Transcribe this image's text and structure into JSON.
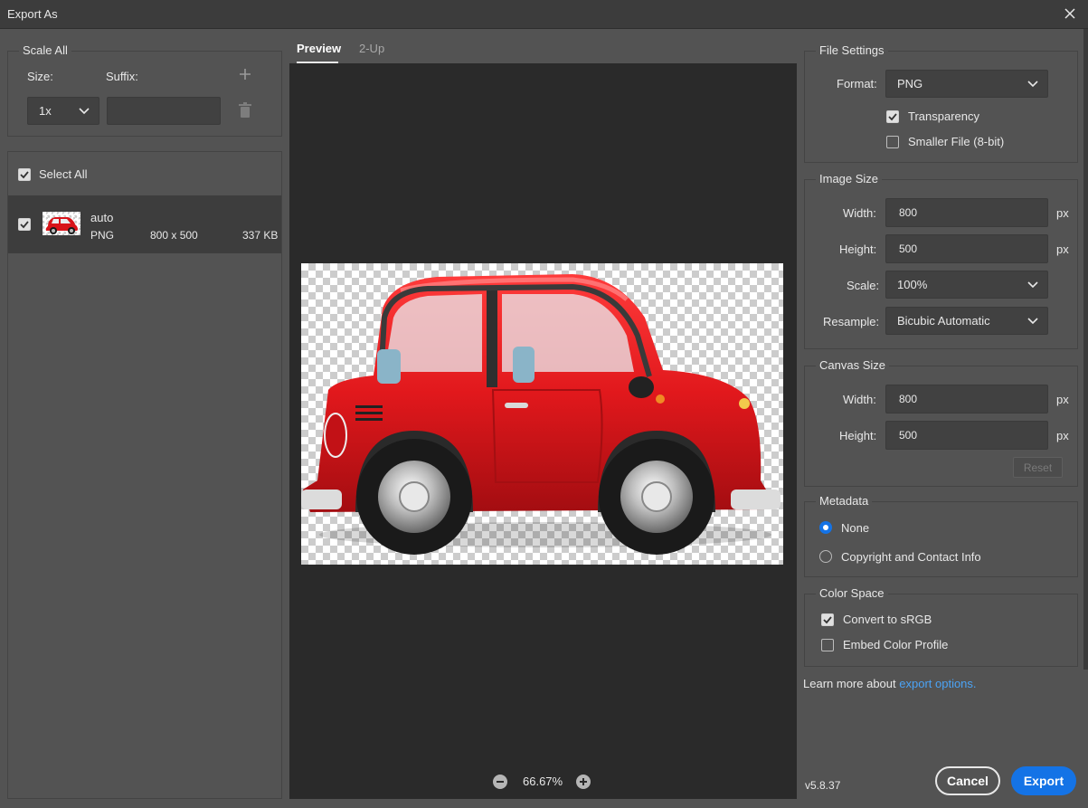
{
  "window": {
    "title": "Export As"
  },
  "scale_all": {
    "legend": "Scale All",
    "size_label": "Size:",
    "suffix_label": "Suffix:",
    "size_value": "1x",
    "suffix_value": ""
  },
  "assets": {
    "select_all_label": "Select All",
    "items": [
      {
        "name": "auto",
        "format": "PNG",
        "dimensions": "800 x 500",
        "filesize": "337 KB"
      }
    ]
  },
  "preview": {
    "tabs": [
      "Preview",
      "2-Up"
    ],
    "active_tab": "Preview",
    "zoom": "66.67%"
  },
  "file_settings": {
    "legend": "File Settings",
    "format_label": "Format:",
    "format_value": "PNG",
    "transparency_label": "Transparency",
    "transparency_checked": true,
    "smaller_file_label": "Smaller File (8-bit)",
    "smaller_file_checked": false
  },
  "image_size": {
    "legend": "Image Size",
    "width_label": "Width:",
    "width_value": "800",
    "height_label": "Height:",
    "height_value": "500",
    "scale_label": "Scale:",
    "scale_value": "100%",
    "resample_label": "Resample:",
    "resample_value": "Bicubic Automatic",
    "unit": "px"
  },
  "canvas_size": {
    "legend": "Canvas Size",
    "width_label": "Width:",
    "width_value": "800",
    "height_label": "Height:",
    "height_value": "500",
    "unit": "px",
    "reset_label": "Reset"
  },
  "metadata": {
    "legend": "Metadata",
    "options": [
      "None",
      "Copyright and Contact Info"
    ],
    "selected": "None"
  },
  "color_space": {
    "legend": "Color Space",
    "convert_label": "Convert to sRGB",
    "convert_checked": true,
    "embed_label": "Embed Color Profile",
    "embed_checked": false
  },
  "footer": {
    "learn_more_text": "Learn more about",
    "learn_more_link": "export options.",
    "version": "v5.8.37",
    "cancel_label": "Cancel",
    "export_label": "Export"
  },
  "colors": {
    "accent": "#1473e6",
    "link": "#4ba3f5",
    "panel_bg": "#535353",
    "preview_bg": "#2a2a2a"
  }
}
